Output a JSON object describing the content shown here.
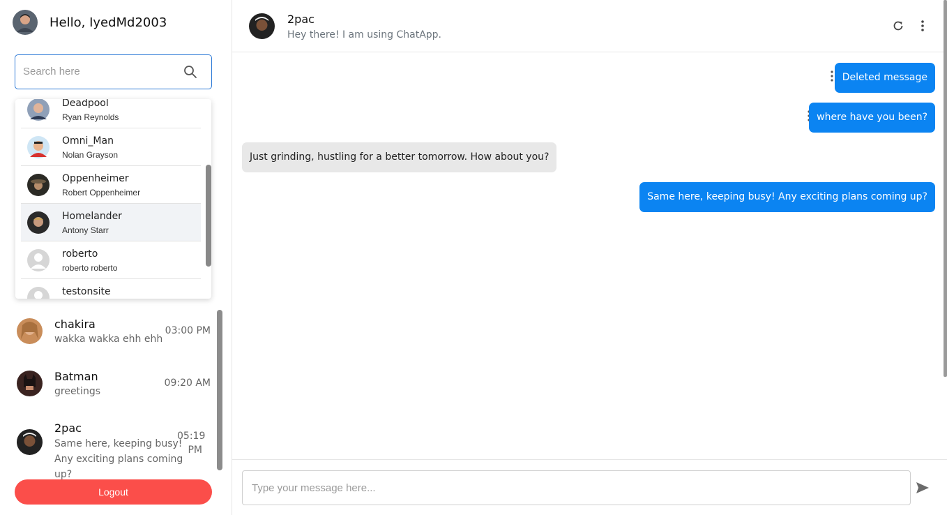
{
  "user": {
    "greeting": "Hello, IyedMd2003",
    "avatar_icon": "user-avatar"
  },
  "search": {
    "placeholder": "Search here",
    "icon": "search-icon"
  },
  "dropdown": {
    "items": [
      {
        "name": "Deadpool",
        "subtitle": "Ryan Reynolds"
      },
      {
        "name": "Omni_Man",
        "subtitle": "Nolan Grayson"
      },
      {
        "name": "Oppenheimer",
        "subtitle": "Robert Oppenheimer"
      },
      {
        "name": "Homelander",
        "subtitle": "Antony Starr"
      },
      {
        "name": "roberto",
        "subtitle": "roberto roberto"
      },
      {
        "name": "testonsite",
        "subtitle": ""
      }
    ]
  },
  "chats": [
    {
      "name": "chakira",
      "last_message": "wakka wakka ehh ehh",
      "time": "03:00 PM"
    },
    {
      "name": "Batman",
      "last_message": "greetings",
      "time": "09:20 AM"
    },
    {
      "name": "2pac",
      "last_message": "Same here, keeping busy! Any exciting plans coming up?",
      "time": "05:19 PM"
    }
  ],
  "logout_label": "Logout",
  "conversation": {
    "contact_name": "2pac",
    "contact_status": "Hey there! I am using ChatApp.",
    "messages": [
      {
        "from": "me",
        "text": "Deleted message"
      },
      {
        "from": "me",
        "text": "where have you been?"
      },
      {
        "from": "them",
        "text": "Just grinding, hustling for a better tomorrow. How about you?"
      },
      {
        "from": "me",
        "text": "Same here, keeping busy! Any exciting plans coming up?"
      }
    ]
  },
  "composer": {
    "placeholder": "Type your message here..."
  },
  "colors": {
    "accent": "#0b84f2",
    "search_border": "#2f7bd7",
    "logout": "#fb4e4a",
    "incoming_bubble": "#e8e8e8"
  }
}
